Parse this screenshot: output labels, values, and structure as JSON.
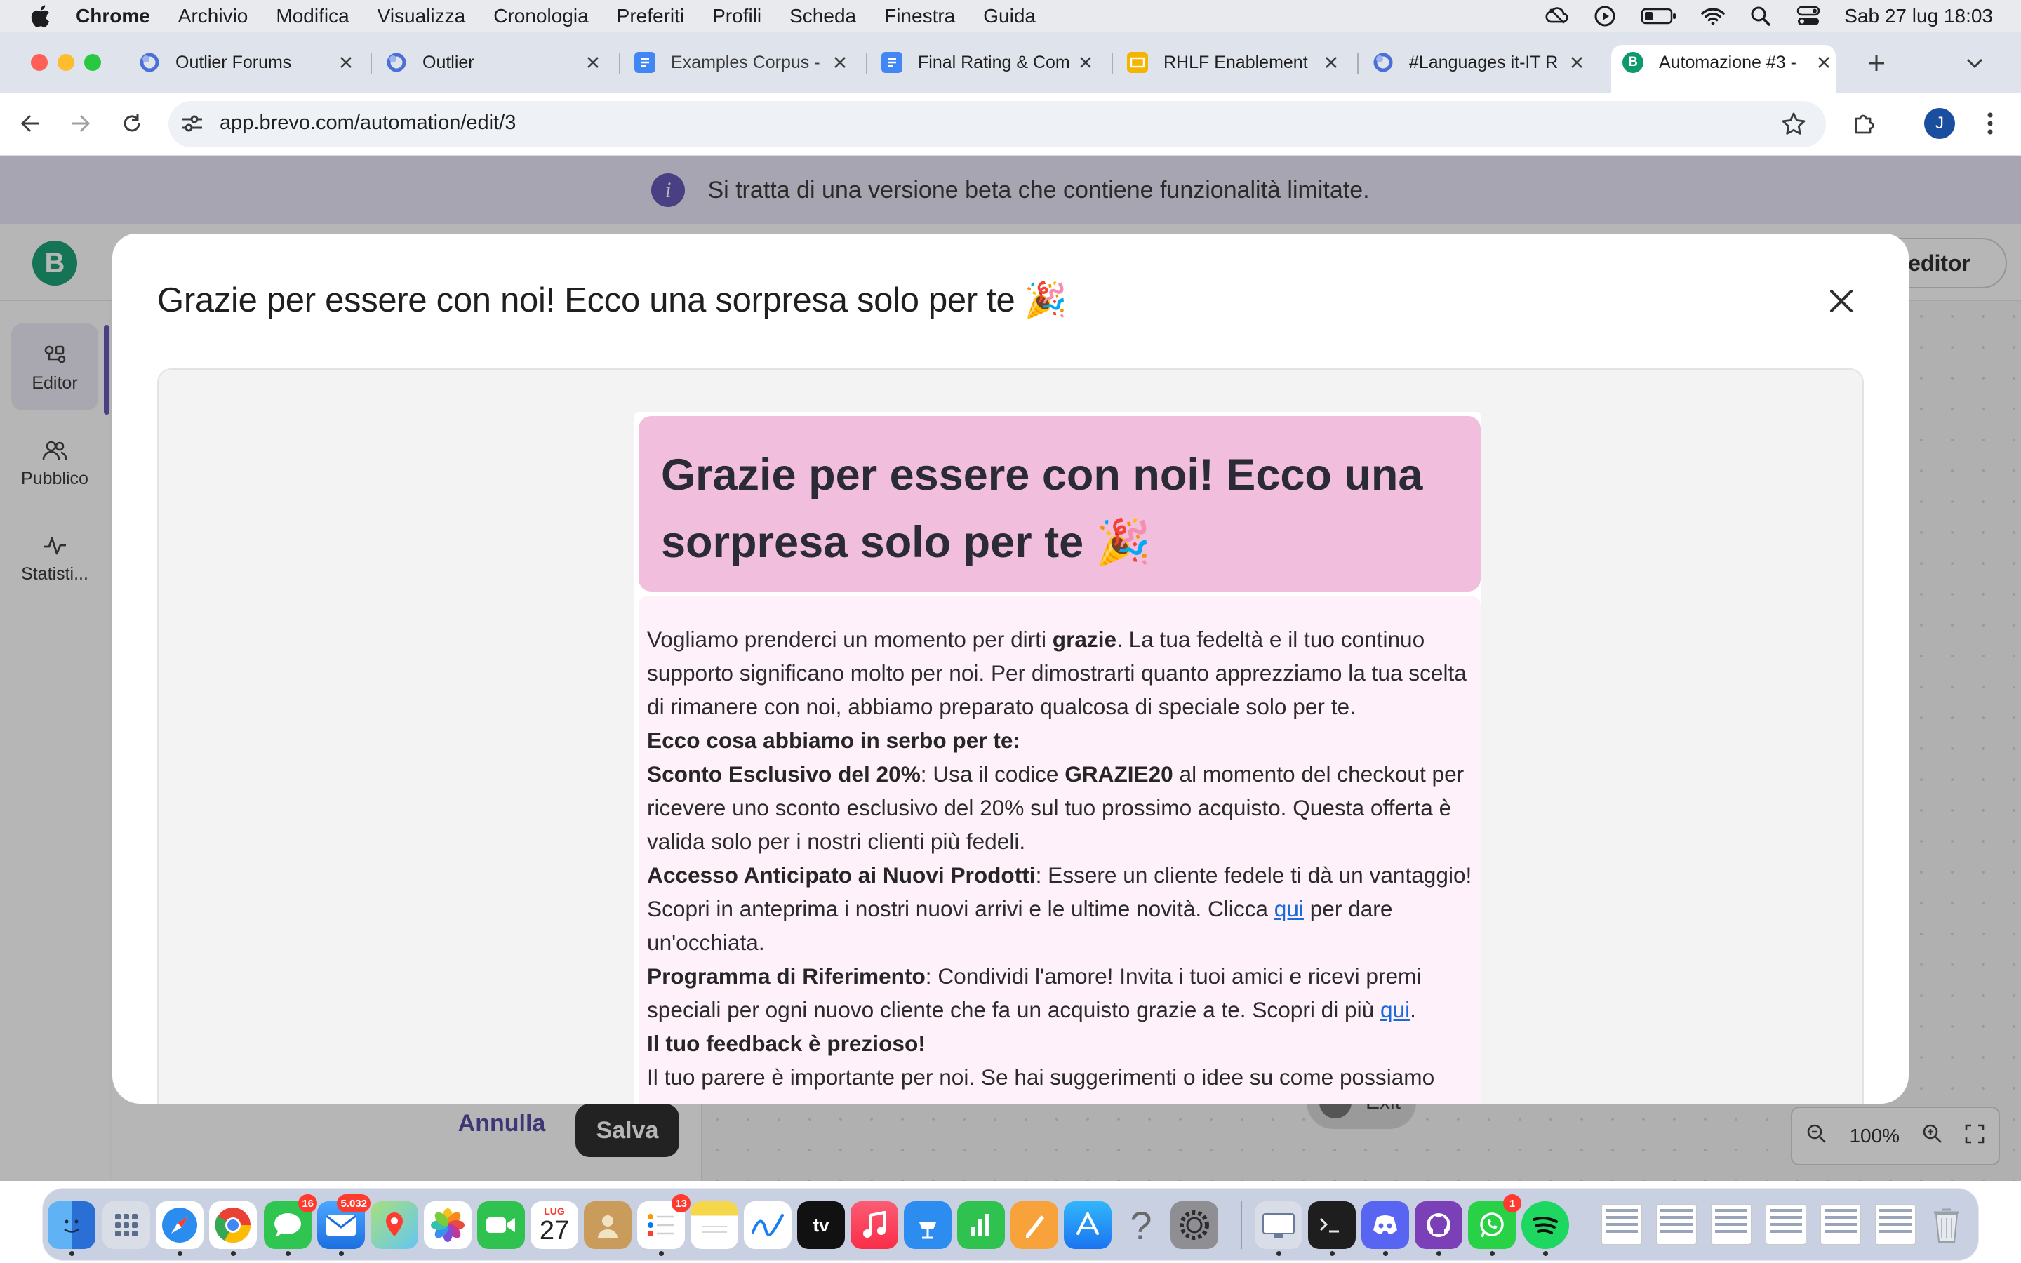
{
  "menubar": {
    "items": [
      "Chrome",
      "Archivio",
      "Modifica",
      "Visualizza",
      "Cronologia",
      "Preferiti",
      "Profili",
      "Scheda",
      "Finestra",
      "Guida"
    ],
    "clock": "Sab 27 lug  18:03"
  },
  "tabs": [
    {
      "label": "Outlier Forums",
      "icon": "outlier-icon"
    },
    {
      "label": "Outlier",
      "icon": "outlier-icon"
    },
    {
      "label": "Examples Corpus -",
      "icon": "docs-icon"
    },
    {
      "label": "Final Rating & Com",
      "icon": "docs-icon"
    },
    {
      "label": "RHLF Enablement",
      "icon": "slides-icon"
    },
    {
      "label": "#Languages it-IT R",
      "icon": "outlier-icon"
    },
    {
      "label": "Automazione #3 -",
      "icon": "brevo-icon",
      "active": true
    }
  ],
  "browser": {
    "url": "app.brevo.com/automation/edit/3",
    "avatar_initial": "J"
  },
  "page": {
    "beta_notice": "Si tratta di una versione beta che contiene funzionalità limitate.",
    "logo_letter": "B",
    "editor_button_partial": "editor",
    "nav": [
      {
        "label": "Editor",
        "icon": "editor-icon",
        "active": true
      },
      {
        "label": "Pubblico",
        "icon": "people-icon"
      },
      {
        "label": "Statisti...",
        "icon": "stats-icon"
      }
    ],
    "cancel_label": "Annulla",
    "save_label": "Salva",
    "exit_label": "Exit",
    "zoom_level": "100%"
  },
  "modal": {
    "title": "Grazie per essere con noi! Ecco una sorpresa solo per te 🎉",
    "email": {
      "heading": "Grazie per essere con noi! Ecco una sorpresa solo per te 🎉",
      "p1_a": "Vogliamo prenderci un momento per dirti ",
      "p1_b": "grazie",
      "p1_c": ". La tua fedeltà e il tuo continuo supporto significano molto per noi. Per dimostrarti quanto apprezziamo la tua scelta di rimanere con noi, abbiamo preparato qualcosa di speciale solo per te.",
      "p2": "Ecco cosa abbiamo in serbo per te:",
      "p3_a": "Sconto Esclusivo del 20%",
      "p3_b": ": Usa il codice ",
      "p3_c": "GRAZIE20",
      "p3_d": " al momento del checkout per ricevere uno sconto esclusivo del 20% sul tuo prossimo acquisto. Questa offerta è valida solo per i nostri clienti più fedeli.",
      "p4_a": "Accesso Anticipato ai Nuovi Prodotti",
      "p4_b": ": Essere un cliente fedele ti dà un vantaggio! Scopri in anteprima i nostri nuovi arrivi e le ultime novità. Clicca ",
      "p4_link": "qui",
      "p4_c": " per dare un'occhiata.",
      "p5_a": "Programma di Riferimento",
      "p5_b": ": Condividi l'amore! Invita i tuoi amici e ricevi premi speciali per ogni nuovo cliente che fa un acquisto grazie a te. Scopri di più ",
      "p5_link": "qui",
      "p5_c": ".",
      "p6": "Il tuo feedback è prezioso!",
      "p7": "Il tuo parere è importante per noi. Se hai suggerimenti o idee su come possiamo"
    }
  },
  "dock": {
    "badges": {
      "messages": "16",
      "mail": "5.032",
      "reminders": "13",
      "whatsapp": "1"
    },
    "calendar_month": "LUG",
    "calendar_day": "27",
    "appletv_label": "tv"
  },
  "colors": {
    "accent": "#5a4bb2",
    "brevo_green": "#0b996e",
    "email_header_bg": "#f1bedd",
    "email_body_bg": "#fff1f9",
    "link": "#1a6ad9"
  }
}
